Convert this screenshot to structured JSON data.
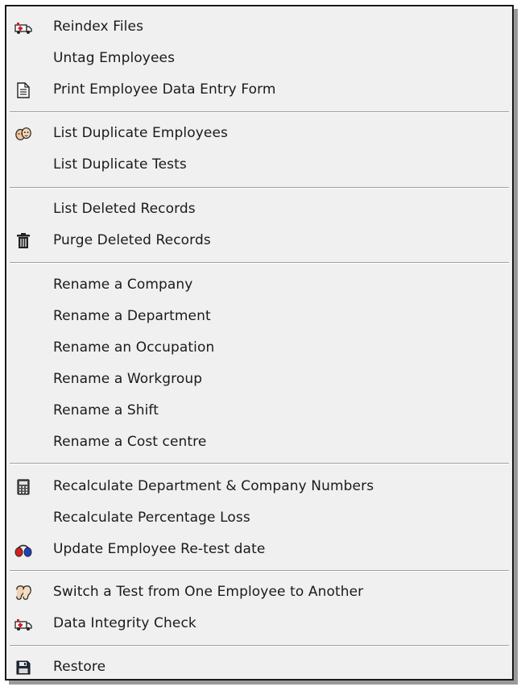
{
  "menu": {
    "items": [
      {
        "label": "Reindex Files",
        "icon": "ambulance-icon"
      },
      {
        "label": "Untag Employees",
        "icon": ""
      },
      {
        "label": "Print Employee Data Entry Form",
        "icon": "document-icon"
      },
      {
        "label": "List Duplicate Employees",
        "icon": "faces-icon"
      },
      {
        "label": "List Duplicate Tests",
        "icon": ""
      },
      {
        "label": "List Deleted Records",
        "icon": ""
      },
      {
        "label": "Purge Deleted Records",
        "icon": "trash-icon"
      },
      {
        "label": "Rename a Company",
        "icon": ""
      },
      {
        "label": "Rename a Department",
        "icon": ""
      },
      {
        "label": "Rename an Occupation",
        "icon": ""
      },
      {
        "label": "Rename a Workgroup",
        "icon": ""
      },
      {
        "label": "Rename a Shift",
        "icon": ""
      },
      {
        "label": "Rename a Cost centre",
        "icon": ""
      },
      {
        "label": "Recalculate Department & Company Numbers",
        "icon": "calculator-icon"
      },
      {
        "label": "Recalculate Percentage Loss",
        "icon": ""
      },
      {
        "label": "Update Employee Re-test date",
        "icon": "headphones-icon"
      },
      {
        "label": "Switch a Test from One Employee to Another",
        "icon": "ears-icon"
      },
      {
        "label": "Data Integrity Check",
        "icon": "ambulance-icon"
      },
      {
        "label": "Restore",
        "icon": "floppy-disk-icon"
      }
    ]
  },
  "colors": {
    "menu_background": "#f0f0f0",
    "text": "#1a1a1a",
    "separator": "#a0a0a0",
    "headphone_red": "#d21f1f",
    "headphone_blue": "#1f3fbf"
  }
}
